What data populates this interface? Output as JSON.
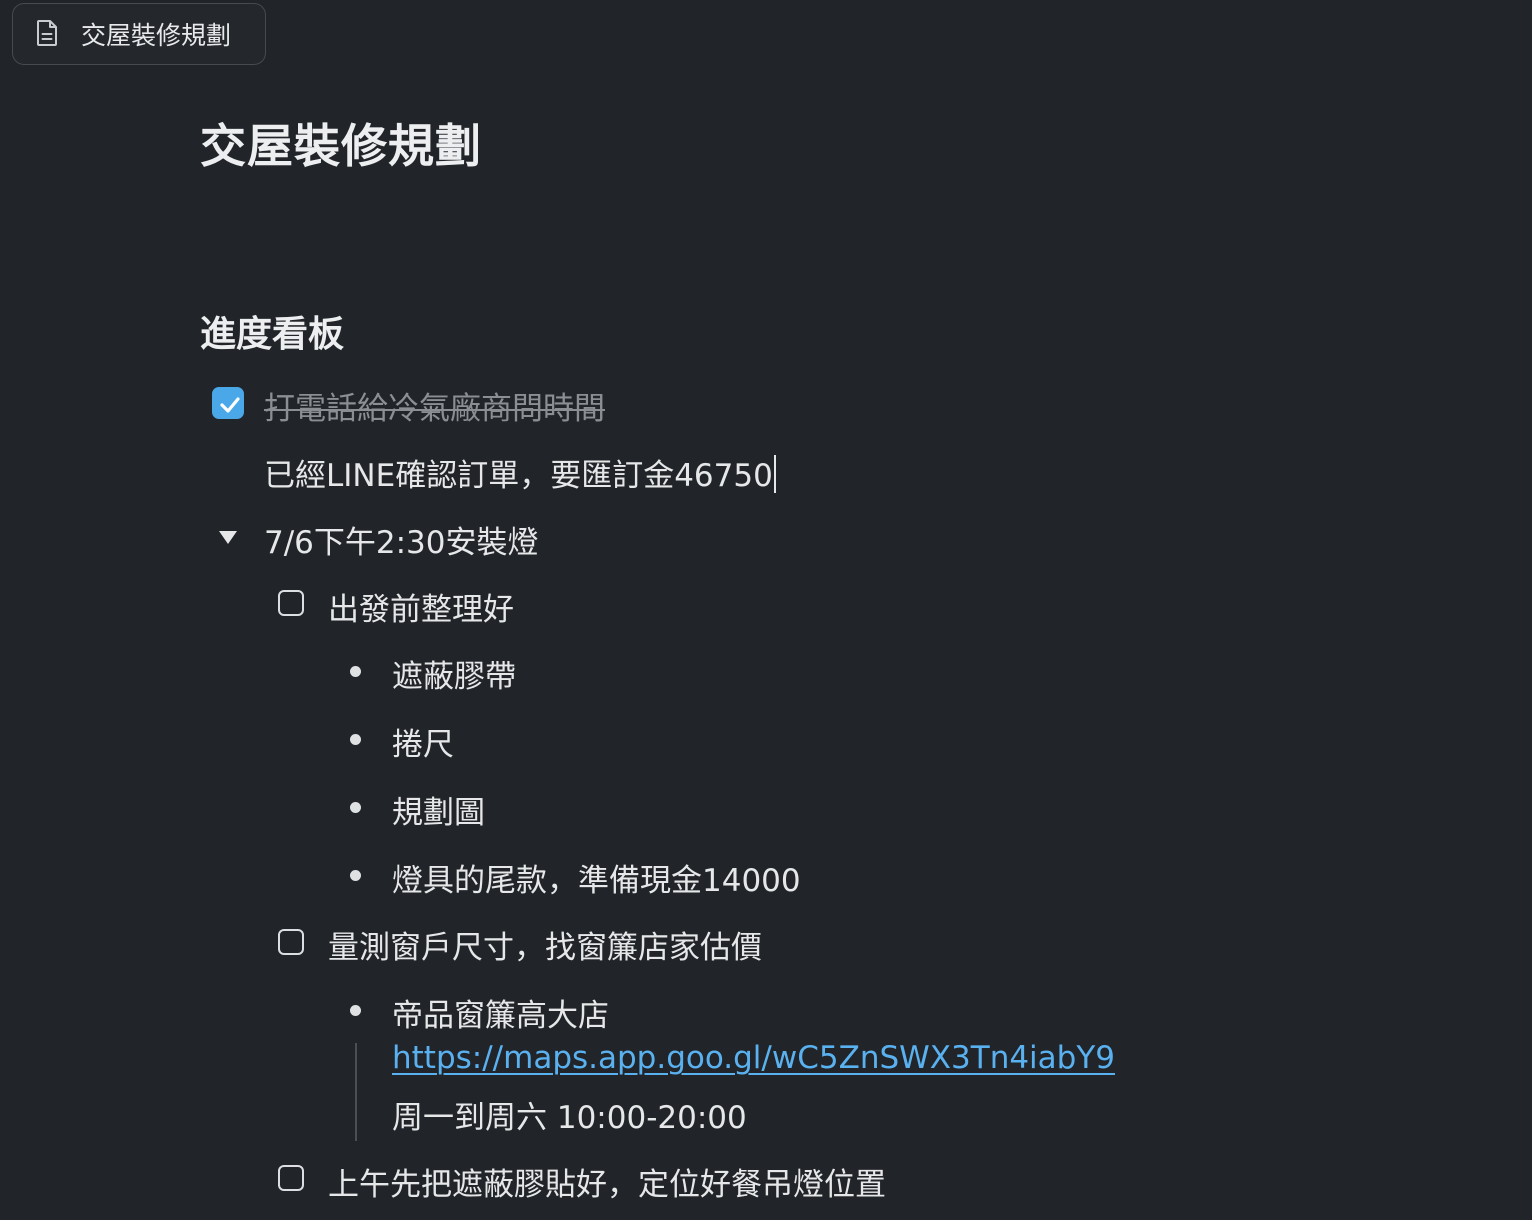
{
  "tab": {
    "label": "交屋裝修規劃",
    "icon": "document-icon"
  },
  "page": {
    "title": "交屋裝修規劃"
  },
  "board": {
    "heading": "進度看板",
    "task1": {
      "text": "打電話給冷氣廠商問時間",
      "checked": true
    },
    "task1_note": "已經LINE確認訂單，要匯訂金46750",
    "toggle": {
      "text": "7/6下午2:30安裝燈",
      "expanded": true
    },
    "sub1": {
      "text": "出發前整理好",
      "checked": false,
      "items": [
        "遮蔽膠帶",
        "捲尺",
        "規劃圖",
        "燈具的尾款，準備現金14000"
      ]
    },
    "sub2": {
      "text": "量測窗戶尺寸，找窗簾店家估價",
      "checked": false,
      "store": {
        "name": "帝品窗簾高大店",
        "link": "https://maps.app.goo.gl/wC5ZnSWX3Tn4iabY9",
        "hours": "周一到周六 10:00-20:00"
      }
    },
    "sub3": {
      "text": "上午先把遮蔽膠貼好，定位好餐吊燈位置",
      "checked": false
    }
  },
  "colors": {
    "background": "#212428",
    "accent": "#4aa8e8",
    "link": "#5ab1f0",
    "muted": "#8b8e93"
  }
}
